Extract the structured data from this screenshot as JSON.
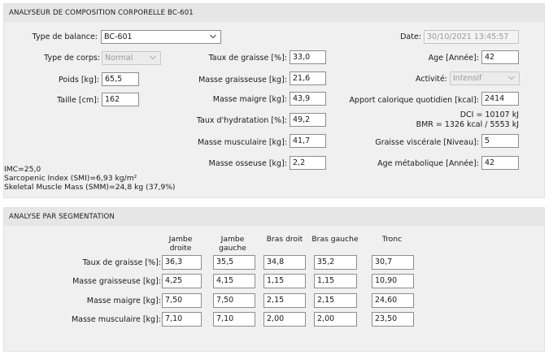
{
  "composition": {
    "title": "ANALYSEUR DE COMPOSITION CORPORELLE BC-601",
    "balance_type": {
      "label": "Type de balance:",
      "value": "BC-601"
    },
    "body_type": {
      "label": "Type de corps:",
      "value": "Normal"
    },
    "weight": {
      "label": "Poids [kg]:",
      "value": "65,5"
    },
    "height": {
      "label": "Taille [cm]:",
      "value": "162"
    },
    "fat_rate": {
      "label": "Taux de graisse [%]:",
      "value": "33,0"
    },
    "fat_mass": {
      "label": "Masse graisseuse [kg]:",
      "value": "21,6"
    },
    "lean_mass": {
      "label": "Masse maigre [kg]:",
      "value": "43,9"
    },
    "hydration": {
      "label": "Taux d'hydratation [%]:",
      "value": "49,2"
    },
    "muscle_mass": {
      "label": "Masse musculaire [kg]:",
      "value": "41,7"
    },
    "bone_mass": {
      "label": "Masse osseuse [kg]:",
      "value": "2,2"
    },
    "date": {
      "label": "Date:",
      "value": "30/10/2021 13:45:57"
    },
    "age": {
      "label": "Age [Année]:",
      "value": "42"
    },
    "activity": {
      "label": "Activité:",
      "value": "Intensif"
    },
    "calorie_intake": {
      "label": "Apport calorique quotidien [kcal]:",
      "value": "2414"
    },
    "dci": "DCI = 10107 kJ",
    "bmr": "BMR = 1326 kcal / 5553 kJ",
    "visceral_fat": {
      "label": "Graisse viscérale [Niveau]:",
      "value": "5"
    },
    "metabolic_age": {
      "label": "Age métabolique [Année]:",
      "value": "42"
    },
    "imc": "IMC=25,0",
    "smi": "Sarcopenic Index (SMI)=6,93 kg/m²",
    "smm": "Skeletal Muscle Mass (SMM)=24,8 kg (37,9%)"
  },
  "segmentation": {
    "title": "ANALYSE PAR SEGMENTATION",
    "columns": [
      {
        "line1": "Jambe",
        "line2": "droite"
      },
      {
        "line1": "Jambe",
        "line2": "gauche"
      },
      {
        "line1": "",
        "line2": "Bras droit"
      },
      {
        "line1": "",
        "line2": "Bras gauche"
      },
      {
        "line1": "",
        "line2": "Tronc"
      }
    ],
    "rows": [
      {
        "label": "Taux de graisse [%]:",
        "values": [
          "36,3",
          "35,5",
          "34,8",
          "35,2",
          "30,7"
        ]
      },
      {
        "label": "Masse graisseuse [kg]:",
        "values": [
          "4,25",
          "4,15",
          "1,15",
          "1,15",
          "10,90"
        ]
      },
      {
        "label": "Masse maigre [kg]:",
        "values": [
          "7,50",
          "7,50",
          "2,15",
          "2,15",
          "24,60"
        ]
      },
      {
        "label": "Masse musculaire [kg]:",
        "values": [
          "7,10",
          "7,10",
          "2,00",
          "2,00",
          "23,50"
        ]
      }
    ]
  },
  "icons": {
    "dropdown": "chevron-down-icon"
  }
}
